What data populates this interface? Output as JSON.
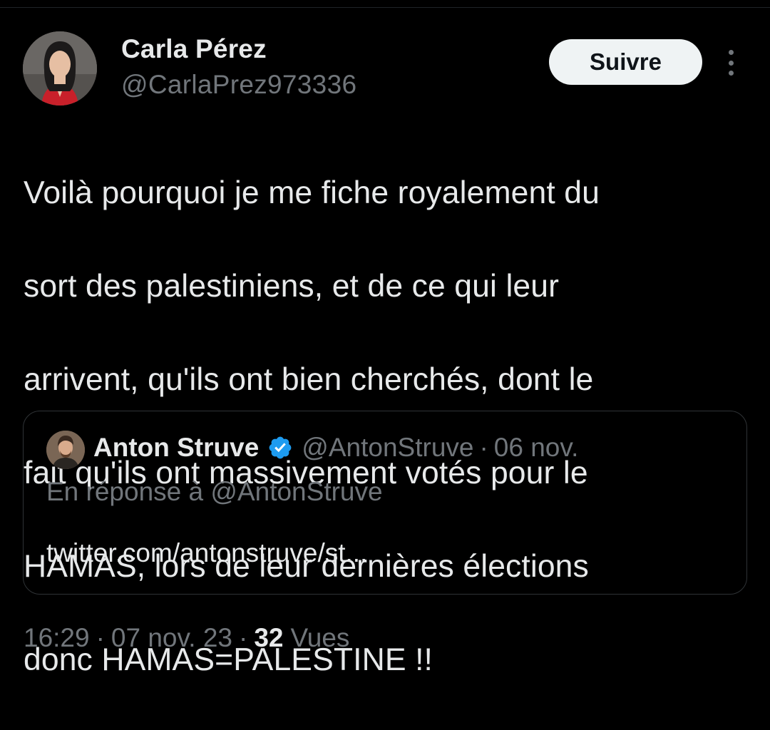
{
  "tweet": {
    "author_name": "Carla Pérez",
    "author_handle": "@CarlaPrez973336",
    "follow_label": "Suivre",
    "text_lines": [
      "Voilà pourquoi je me fiche royalement du",
      "sort des palestiniens, et de ce qui leur",
      "arrivent, qu'ils ont bien cherchés, dont le",
      "fait qu'ils ont massivement votés pour le",
      "HAMAS, lors de leur dernières élections",
      "donc HAMAS=PALESTINE !!"
    ]
  },
  "quote": {
    "author_name": "Anton Struve",
    "author_handle": "@AntonStruve",
    "separator": "·",
    "date": "06 nov.",
    "reply_to": "En réponse à @AntonStruve",
    "link_text": "twitter.com/antonstruve/st..."
  },
  "meta": {
    "time": "16:29",
    "separator": "·",
    "date": "07 nov. 23",
    "views_count": "32",
    "views_label": "Vues"
  },
  "icons": {
    "more": "more-vertical-icon",
    "verified": "verified-badge-icon"
  },
  "colors": {
    "background": "#000000",
    "primary_text": "#e7e9ea",
    "secondary_text": "#71767b",
    "follow_button_bg": "#eff3f4",
    "verified_blue": "#1d9bf0",
    "border": "#2f3336"
  }
}
